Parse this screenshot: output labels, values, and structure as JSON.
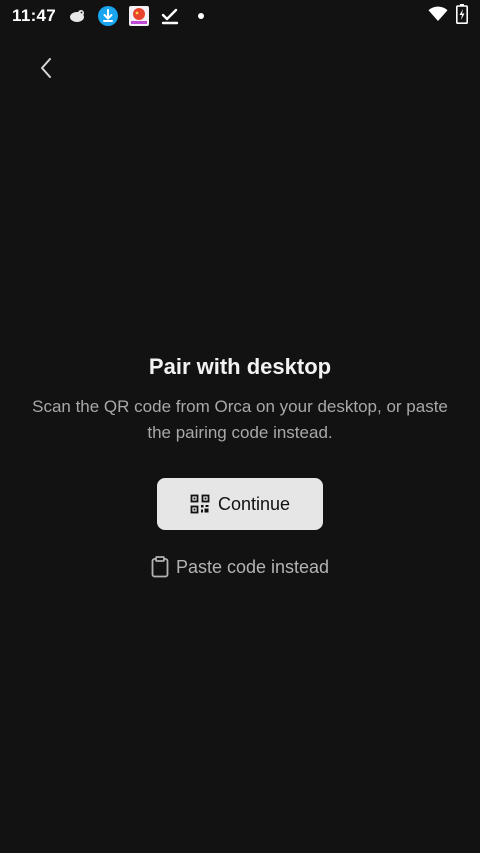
{
  "status_bar": {
    "time": "11:47",
    "notifications": [
      "cloud-bird-icon",
      "download-icon",
      "app-icon",
      "checklist-icon",
      "dot-icon"
    ],
    "right_icons": [
      "wifi-icon",
      "battery-charging-icon"
    ]
  },
  "header": {
    "back_icon": "chevron-left-icon"
  },
  "pairing": {
    "title": "Pair with desktop",
    "subtitle": "Scan the QR code from Orca on your desktop, or paste the pairing code instead.",
    "continue_label": "Continue",
    "paste_label": "Paste code instead"
  },
  "colors": {
    "background": "#121212",
    "button_bg": "#e6e6e6",
    "text_secondary": "#a8a8a8"
  }
}
